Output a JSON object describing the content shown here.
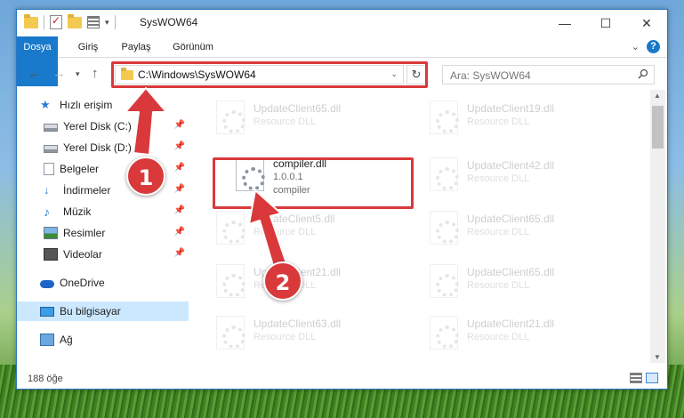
{
  "window": {
    "title": "SysWOW64",
    "controls": {
      "minimize": "—",
      "maximize": "☐",
      "close": "✕"
    }
  },
  "ribbon": {
    "tabs": [
      {
        "label": "Dosya"
      },
      {
        "label": "Giriş"
      },
      {
        "label": "Paylaş"
      },
      {
        "label": "Görünüm"
      }
    ],
    "expand_icon": "chevron-down-icon",
    "help_label": "?"
  },
  "nav": {
    "back_icon": "back-arrow-icon",
    "forward_icon": "forward-arrow-icon",
    "recent_icon": "chevron-down-icon",
    "up_icon": "up-arrow-icon",
    "address": "C:\\Windows\\SysWOW64",
    "refresh_icon": "refresh-icon",
    "search_placeholder": "Ara: SysWOW64"
  },
  "sidebar": {
    "items": [
      {
        "label": "Hızlı erişim",
        "icon": "star-icon"
      },
      {
        "label": "Yerel Disk (C:)",
        "icon": "disk-icon",
        "pinned": true
      },
      {
        "label": "Yerel Disk (D:)",
        "icon": "disk-icon",
        "pinned": true
      },
      {
        "label": "Belgeler",
        "icon": "document-icon",
        "pinned": true
      },
      {
        "label": "İndirmeler",
        "icon": "download-icon",
        "pinned": true
      },
      {
        "label": "Müzik",
        "icon": "music-icon",
        "pinned": true
      },
      {
        "label": "Resimler",
        "icon": "picture-icon",
        "pinned": true
      },
      {
        "label": "Videolar",
        "icon": "video-icon",
        "pinned": true
      },
      {
        "label": "OneDrive",
        "icon": "cloud-icon"
      },
      {
        "label": "Bu bilgisayar",
        "icon": "computer-icon",
        "selected": true
      },
      {
        "label": "Ağ",
        "icon": "network-icon"
      }
    ]
  },
  "files": [
    {
      "name": "UpdateClient65.dll",
      "line1": "Resource DLL",
      "line2": ""
    },
    {
      "name": "UpdateClient19.dll",
      "line1": "Resource DLL",
      "line2": ""
    },
    {
      "name": "compiler.dll",
      "line1": "1.0.0.1",
      "line2": "compiler"
    },
    {
      "name": "UpdateClient42.dll",
      "line1": "Resource DLL",
      "line2": ""
    },
    {
      "name": "UpdateClient5.dll",
      "line1": "Resource DLL",
      "line2": ""
    },
    {
      "name": "UpdateClient65.dll",
      "line1": "Resource DLL",
      "line2": ""
    },
    {
      "name": "UpdateClient21.dll",
      "line1": "Resource DLL",
      "line2": ""
    },
    {
      "name": "UpdateClient65.dll",
      "line1": "Resource DLL",
      "line2": ""
    },
    {
      "name": "UpdateClient63.dll",
      "line1": "Resource DLL",
      "line2": ""
    },
    {
      "name": "UpdateClient21.dll",
      "line1": "Resource DLL",
      "line2": ""
    }
  ],
  "status": {
    "item_count": "188 öğe"
  },
  "callouts": {
    "step1": "1",
    "step2": "2"
  },
  "colors": {
    "accent": "#1979ca",
    "highlight": "#d9393b",
    "selected": "#cce8ff"
  }
}
